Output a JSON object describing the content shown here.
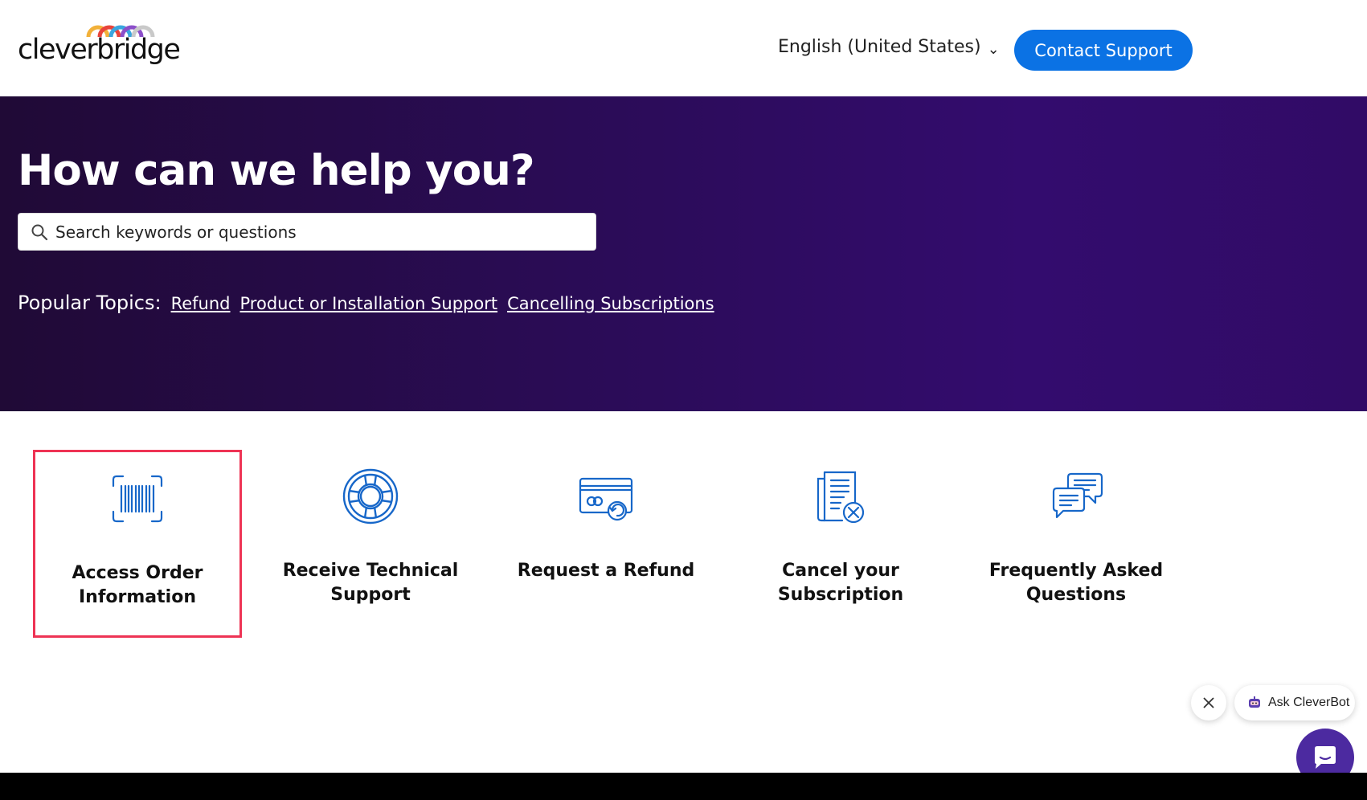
{
  "header": {
    "logo_text": "cleverbridge",
    "language": "English (United States)",
    "contact_label": "Contact Support"
  },
  "hero": {
    "title": "How can we help you?",
    "search_placeholder": "Search keywords or questions",
    "popular_label": "Popular Topics:",
    "topics": [
      "Refund",
      "Product or Installation Support",
      "Cancelling Subscriptions"
    ]
  },
  "cards": [
    {
      "line1": "Access Order",
      "line2": "Information",
      "icon": "barcode-icon"
    },
    {
      "line1": "Receive Technical",
      "line2": "Support",
      "icon": "lifebuoy-icon"
    },
    {
      "line1": "Request a Refund",
      "line2": "",
      "icon": "credit-card-refund-icon"
    },
    {
      "line1": "Cancel your",
      "line2": "Subscription",
      "icon": "document-cancel-icon"
    },
    {
      "line1": "Frequently Asked",
      "line2": "Questions",
      "icon": "chat-bubbles-icon"
    }
  ],
  "chat": {
    "label": "Ask CleverBot"
  },
  "colors": {
    "accent": "#0b72e4",
    "icon_blue": "#1767c9",
    "selected_border": "#ee3354",
    "chat_launcher": "#4c2aa0"
  }
}
